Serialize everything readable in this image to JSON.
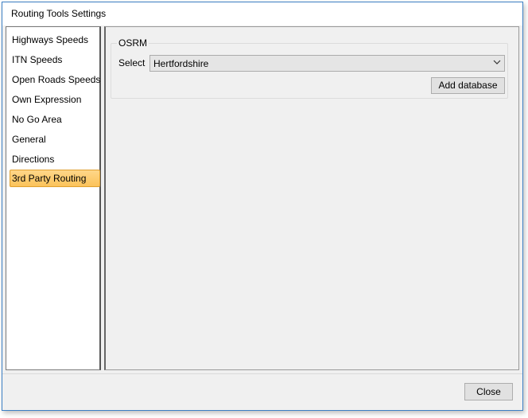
{
  "window": {
    "title": "Routing Tools Settings"
  },
  "nav": {
    "items": [
      {
        "label": "Highways Speeds",
        "selected": false
      },
      {
        "label": "ITN Speeds",
        "selected": false
      },
      {
        "label": "Open Roads Speeds",
        "selected": false
      },
      {
        "label": "Own Expression",
        "selected": false
      },
      {
        "label": "No Go Area",
        "selected": false
      },
      {
        "label": "General",
        "selected": false
      },
      {
        "label": "Directions",
        "selected": false
      },
      {
        "label": "3rd Party Routing",
        "selected": true
      }
    ]
  },
  "osrm": {
    "group_title": "OSRM",
    "select_label": "Select",
    "select_value": "Hertfordshire",
    "add_database_label": "Add database"
  },
  "footer": {
    "close_label": "Close"
  },
  "colors": {
    "selection": "#fbc35a",
    "window_border": "#3c7fc4",
    "panel_bg": "#f0f0f0"
  },
  "icons": {
    "dropdown": "chevron-down-icon"
  }
}
